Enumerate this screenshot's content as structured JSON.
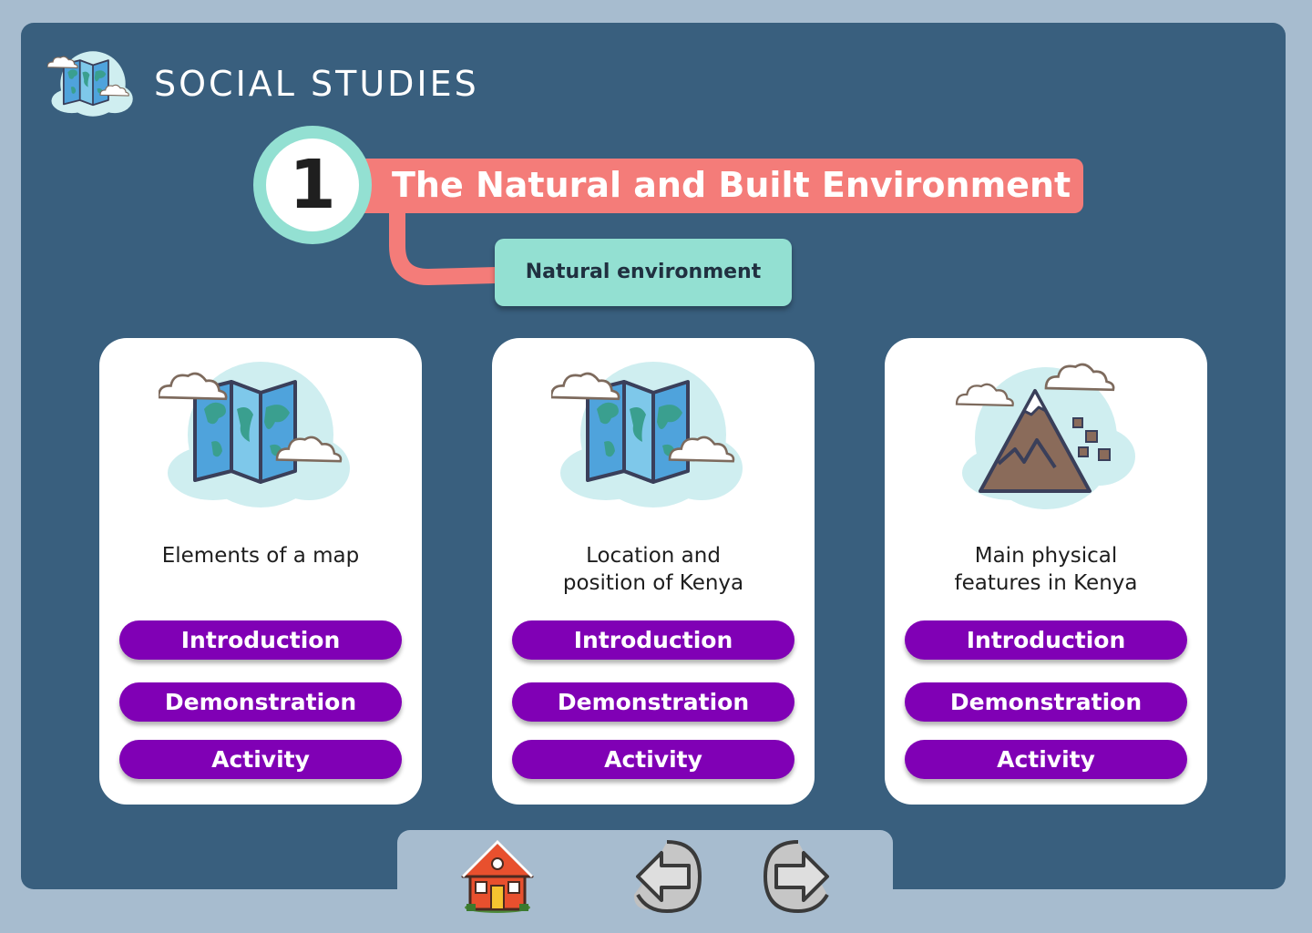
{
  "app": {
    "title": "SOCIAL STUDIES",
    "logo_icon": "world-map-icon"
  },
  "unit": {
    "number": "1",
    "title": "The Natural and Built Environment",
    "subtopic": "Natural environment"
  },
  "cards": [
    {
      "icon": "world-map-icon",
      "label": "Elements of a map",
      "buttons": {
        "introduction": "Introduction",
        "demonstration": "Demonstration",
        "activity": "Activity"
      }
    },
    {
      "icon": "world-map-icon",
      "label": "Location and\nposition of Kenya",
      "buttons": {
        "introduction": "Introduction",
        "demonstration": "Demonstration",
        "activity": "Activity"
      }
    },
    {
      "icon": "mountain-icon",
      "label": "Main physical\nfeatures in Kenya",
      "buttons": {
        "introduction": "Introduction",
        "demonstration": "Demonstration",
        "activity": "Activity"
      }
    }
  ],
  "nav": {
    "home_icon": "home-icon",
    "back_icon": "arrow-left-icon",
    "forward_icon": "arrow-right-icon"
  },
  "colors": {
    "background": "#a7bccf",
    "panel": "#395f7e",
    "banner": "#f47c79",
    "mint": "#93e0d2",
    "button": "#8000b5"
  }
}
